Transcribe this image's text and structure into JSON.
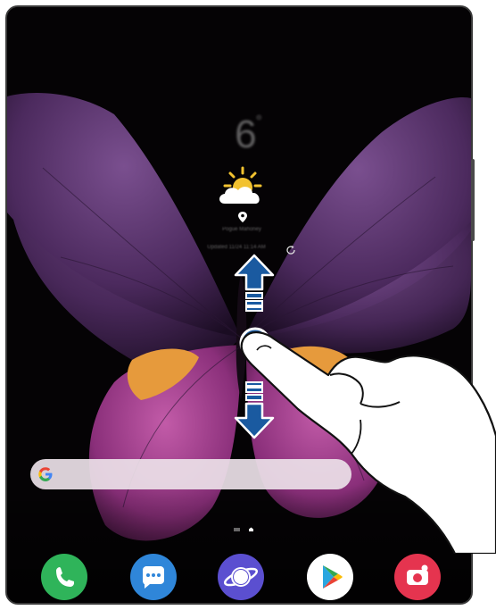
{
  "home_screen": {
    "weather": {
      "temperature": "6",
      "degree_symbol": "°",
      "location": "Pogue Mahoney",
      "updated": "Updated 11/24 11:14 AM"
    },
    "gesture": {
      "description_icons": [
        "swipe-up-arrow-icon",
        "swipe-down-arrow-icon",
        "touch-point-icon"
      ]
    },
    "search_bar": {
      "icon": "google-icon"
    },
    "dock": {
      "apps": [
        {
          "name": "Phone",
          "icon": "phone-icon",
          "color": "#2fb45a"
        },
        {
          "name": "Messages",
          "icon": "messages-icon",
          "color": "#2f86d9"
        },
        {
          "name": "Internet",
          "icon": "internet-icon",
          "color": "#5b4fd0"
        },
        {
          "name": "Play Store",
          "icon": "play-store-icon",
          "color": "#ffffff"
        },
        {
          "name": "Camera",
          "icon": "camera-icon",
          "color": "#e5344f"
        }
      ]
    }
  },
  "colors": {
    "arrow_blue": "#1a5aa0",
    "frame": "#3a3a3a"
  }
}
